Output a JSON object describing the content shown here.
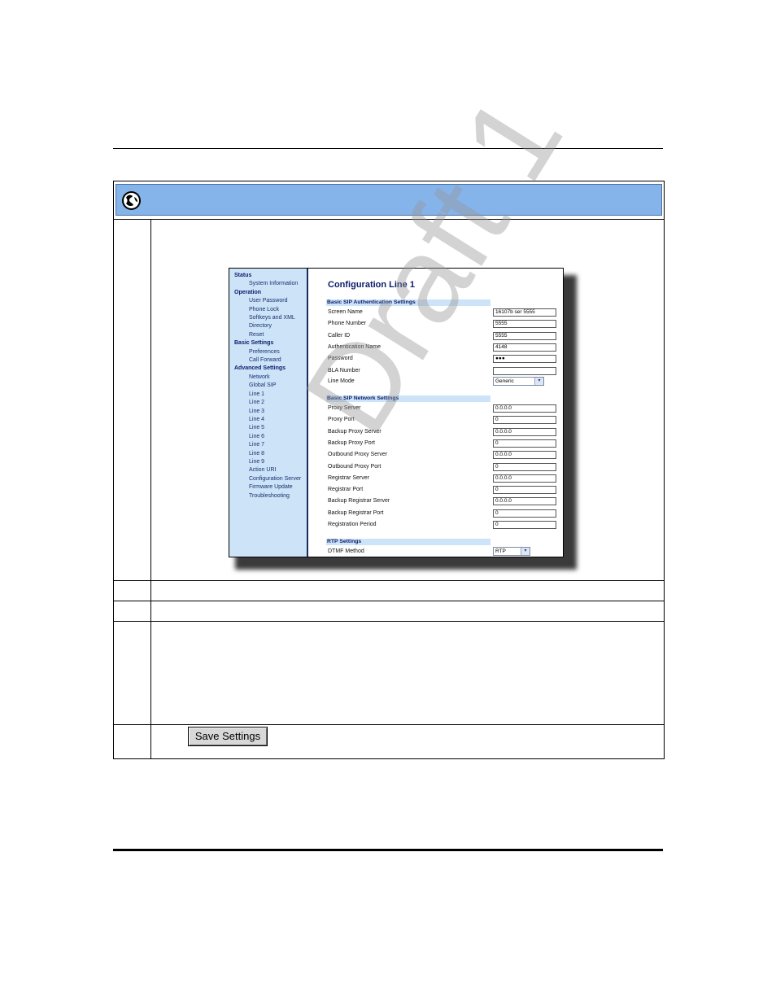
{
  "config_screen": {
    "title": "Configuration Line 1",
    "nav": [
      {
        "type": "header",
        "label": "Status"
      },
      {
        "type": "item",
        "label": "System Information"
      },
      {
        "type": "header",
        "label": "Operation"
      },
      {
        "type": "item",
        "label": "User Password"
      },
      {
        "type": "item",
        "label": "Phone Lock"
      },
      {
        "type": "item",
        "label": "Softkeys and XML"
      },
      {
        "type": "item",
        "label": "Directory"
      },
      {
        "type": "item",
        "label": "Reset"
      },
      {
        "type": "header",
        "label": "Basic Settings"
      },
      {
        "type": "item",
        "label": "Preferences"
      },
      {
        "type": "item",
        "label": "Call Forward"
      },
      {
        "type": "header",
        "label": "Advanced Settings"
      },
      {
        "type": "item",
        "label": "Network"
      },
      {
        "type": "item",
        "label": "Global SIP"
      },
      {
        "type": "item",
        "label": "Line 1"
      },
      {
        "type": "item",
        "label": "Line 2"
      },
      {
        "type": "item",
        "label": "Line 3"
      },
      {
        "type": "item",
        "label": "Line 4"
      },
      {
        "type": "item",
        "label": "Line 5"
      },
      {
        "type": "item",
        "label": "Line 6"
      },
      {
        "type": "item",
        "label": "Line 7"
      },
      {
        "type": "item",
        "label": "Line 8"
      },
      {
        "type": "item",
        "label": "Line 9"
      },
      {
        "type": "item",
        "label": "Action URI"
      },
      {
        "type": "item",
        "label": "Configuration Server"
      },
      {
        "type": "item",
        "label": "Firmware Update"
      },
      {
        "type": "item",
        "label": "Troubleshooting"
      }
    ],
    "auth_section": "Basic SIP Authentication Settings",
    "auth_fields": [
      {
        "label": "Screen Name",
        "value": "16107b ser 5555"
      },
      {
        "label": "Phone Number",
        "value": "5555"
      },
      {
        "label": "Caller ID",
        "value": "5555"
      },
      {
        "label": "Authentication Name",
        "value": "4148"
      },
      {
        "label": "Password",
        "value": "●●●"
      },
      {
        "label": "BLA Number",
        "value": ""
      }
    ],
    "line_mode": {
      "label": "Line Mode",
      "value": "Generic"
    },
    "network_section": "Basic SIP Network Settings",
    "network_fields": [
      {
        "label": "Proxy Server",
        "value": "0.0.0.0"
      },
      {
        "label": "Proxy Port",
        "value": "0"
      },
      {
        "label": "Backup Proxy Server",
        "value": "0.0.0.0"
      },
      {
        "label": "Backup Proxy Port",
        "value": "0"
      },
      {
        "label": "Outbound Proxy Server",
        "value": "0.0.0.0"
      },
      {
        "label": "Outbound Proxy Port",
        "value": "0"
      },
      {
        "label": "Registrar Server",
        "value": "0.0.0.0"
      },
      {
        "label": "Registrar Port",
        "value": "0"
      },
      {
        "label": "Backup Registrar Server",
        "value": "0.0.0.0"
      },
      {
        "label": "Backup Registrar Port",
        "value": "0"
      },
      {
        "label": "Registration Period",
        "value": "0"
      }
    ],
    "rtp_section": "RTP Settings",
    "dtmf": {
      "label": "DTMF Method",
      "value": "RTP"
    }
  },
  "save_button": "Save Settings",
  "watermark": "Draft 1",
  "icons": {
    "banner": "globe-icon",
    "dropdown": "chevron-down-icon"
  },
  "colors": {
    "banner": "#85b4ea",
    "nav_bg": "#cde3f8",
    "title": "#0a1d6b"
  }
}
